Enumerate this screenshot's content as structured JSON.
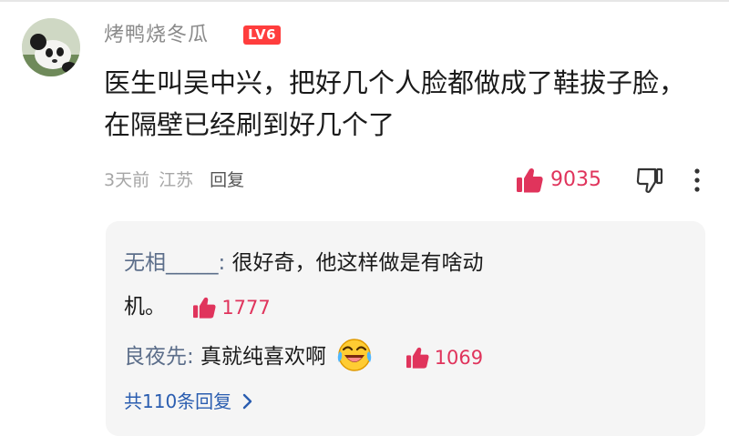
{
  "comment": {
    "username": "烤鸭烧冬瓜",
    "level_badge": "LV6",
    "text": "医生叫吴中兴，把好几个人脸都做成了鞋拔子脸，在隔壁已经刷到好几个了",
    "time": "3天前",
    "location": "江苏",
    "reply_label": "回复",
    "like_count": "9035"
  },
  "replies": [
    {
      "user": "无相_____",
      "separator": ":",
      "text_line1": " 很好奇，他这样做是有啥动",
      "text_line2": "机。",
      "like_count": "1777"
    },
    {
      "user": "良夜先",
      "separator": ":",
      "text": " 真就纯喜欢啊",
      "emoji": "laughing-crying-emoji",
      "like_count": "1069"
    }
  ],
  "more_replies_label": "共110条回复",
  "colors": {
    "like": "#e0345c",
    "level_badge": "#ff3d3d",
    "reply_user": "#5c6e8a",
    "more_link": "#2a5db0"
  }
}
